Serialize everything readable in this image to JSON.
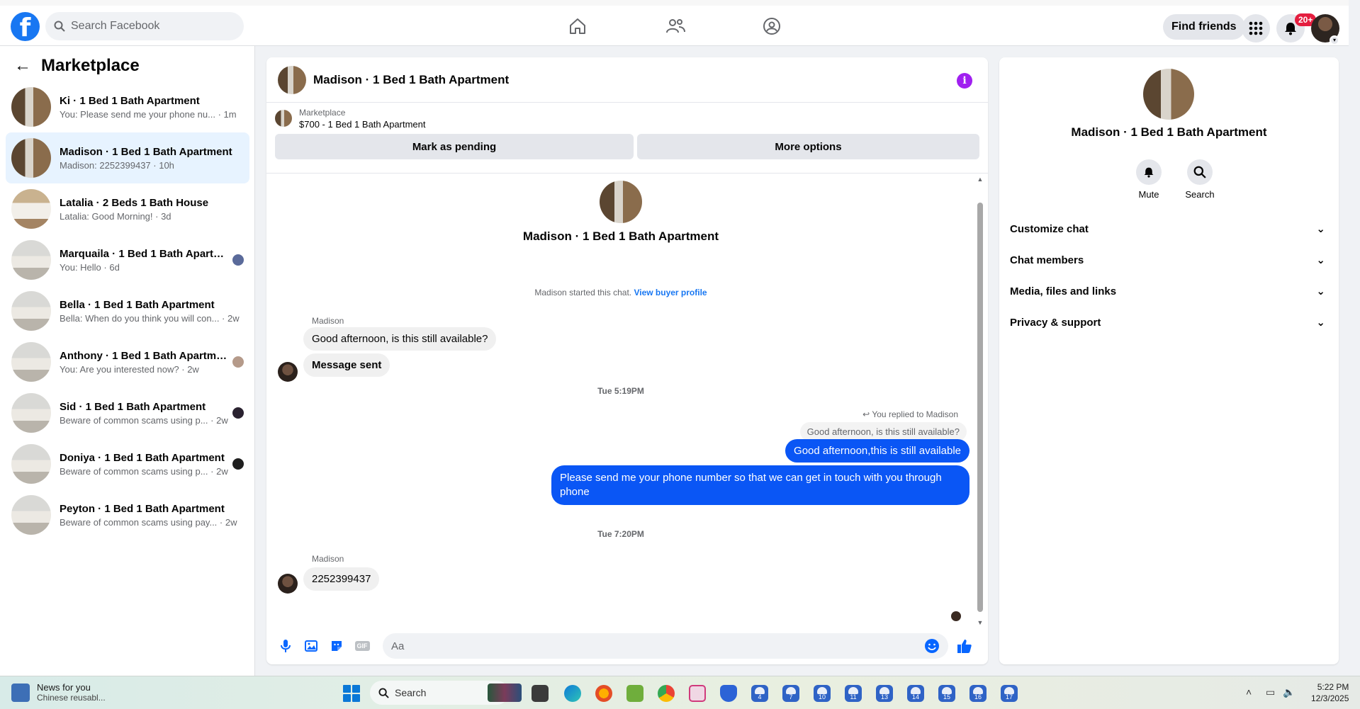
{
  "topbar": {
    "logo": "f",
    "search_placeholder": "Search Facebook",
    "find_friends": "Find friends",
    "notif_count": "20+",
    "colors": {
      "brand": "#1877f2",
      "badge": "#e41e3f"
    }
  },
  "sidebar": {
    "title": "Marketplace",
    "conversations": [
      {
        "title": "Ki · 1 Bed 1 Bath Apartment",
        "preview": "You: Please send me your phone nu... · 1m"
      },
      {
        "title": "Madison · 1 Bed 1 Bath Apartment",
        "preview": "Madison: 2252399437 · 10h"
      },
      {
        "title": "Latalia · 2 Beds 1 Bath House",
        "preview": "Latalia: Good Morning! · 3d"
      },
      {
        "title": "Marquaila · 1 Bed 1 Bath Apartm...",
        "preview": "You: Hello · 6d"
      },
      {
        "title": "Bella · 1 Bed 1 Bath Apartment",
        "preview": "Bella: When do you think you will con... · 2w"
      },
      {
        "title": "Anthony · 1 Bed 1 Bath Apartment",
        "preview": "You: Are you interested now? · 2w"
      },
      {
        "title": "Sid · 1 Bed 1 Bath Apartment",
        "preview": "Beware of common scams using p... · 2w"
      },
      {
        "title": "Doniya · 1 Bed 1 Bath Apartment",
        "preview": "Beware of common scams using p... · 2w"
      },
      {
        "title": "Peyton · 1 Bed 1 Bath Apartment",
        "preview": "Beware of common scams using pay... · 2w"
      }
    ]
  },
  "chat": {
    "header_name": "Madison · 1 Bed 1 Bath Apartment",
    "listing_category": "Marketplace",
    "listing_price": "$700 - 1 Bed 1 Bath Apartment",
    "mark_pending": "Mark as pending",
    "more_options": "More options",
    "center_name": "Madison · 1 Bed 1 Bath Apartment",
    "started_text": "Madison started this chat.",
    "view_profile": "View buyer profile",
    "sender_1": "Madison",
    "msg_1": "Good afternoon, is this still available?",
    "msg_2": "Message sent",
    "time_1": "Tue 5:19PM",
    "replied_to": "You replied to Madison",
    "quoted": "Good afternoon, is this still available?",
    "out_1": "Good afternoon,this is still available",
    "out_2": "Please send me your phone  number so that we can get in touch with you through phone",
    "time_2": "Tue 7:20PM",
    "sender_2": "Madison",
    "msg_3": "2252399437",
    "composer_placeholder": "Aa",
    "gif_label": "GIF",
    "colors": {
      "outgoing": "#0a56f5",
      "incoming": "#f0f0f0",
      "link": "#1877f2"
    }
  },
  "rpanel": {
    "name": "Madison · 1 Bed 1 Bath Apartment",
    "mute": "Mute",
    "search": "Search",
    "sections": [
      "Customize chat",
      "Chat members",
      "Media, files and links",
      "Privacy & support"
    ]
  },
  "taskbar": {
    "news_title": "News for you",
    "news_sub": "Chinese reusabl...",
    "search_placeholder": "Search",
    "badges": [
      "4",
      "7",
      "10",
      "11",
      "13",
      "14",
      "15",
      "16",
      "17"
    ],
    "time": "5:22 PM",
    "date": "12/3/2025"
  }
}
